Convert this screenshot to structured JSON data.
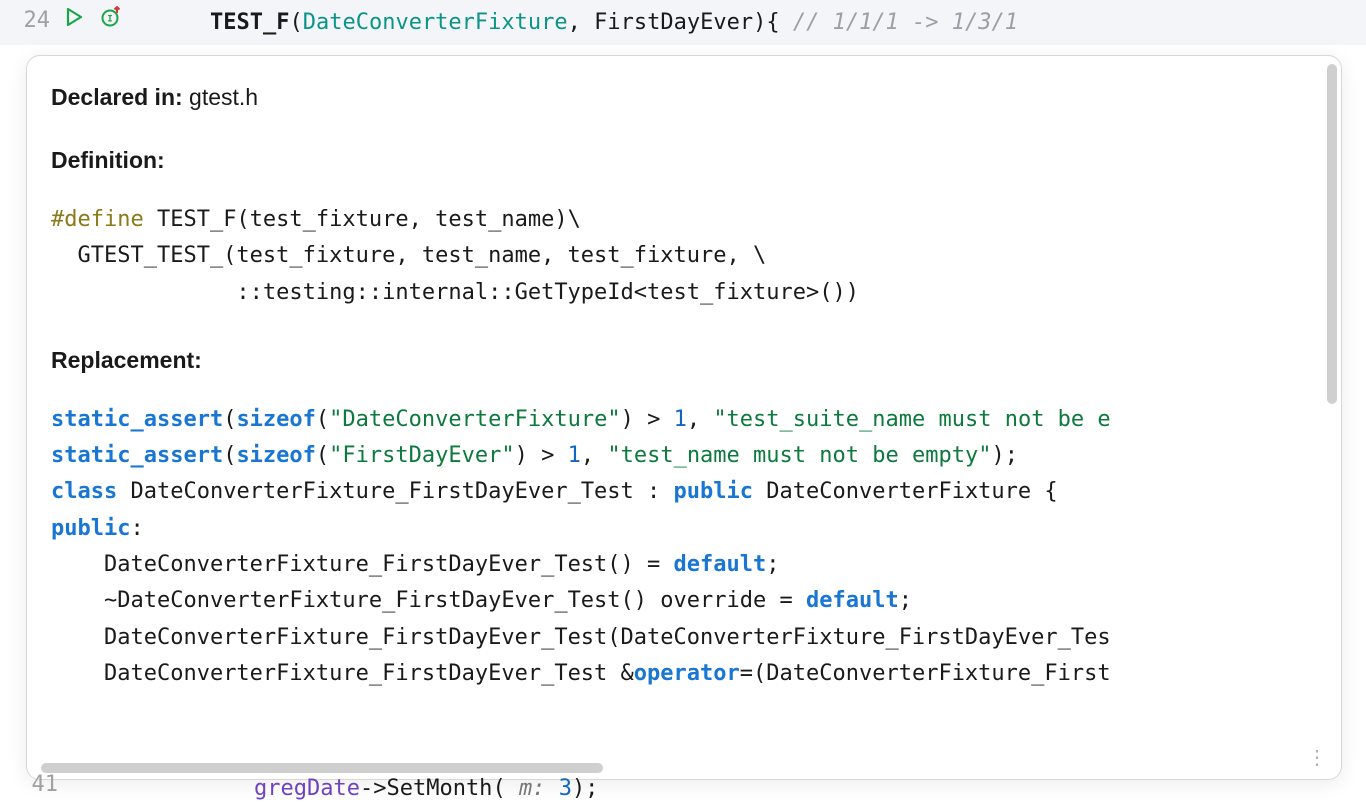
{
  "editor": {
    "line24": {
      "number": "24",
      "macro": "TEST_F",
      "arg1": "DateConverterFixture",
      "sep": ", ",
      "arg2": "FirstDayEver",
      "brace": "){ ",
      "comment": "// 1/1/1 -> 1/3/1"
    },
    "line41": {
      "number": "41",
      "indent": "        ",
      "obj": "gregDate",
      "arrow": "->",
      "method": "SetMonth",
      "open": "( ",
      "param_hint": "m: ",
      "value": "3",
      "close": ");"
    }
  },
  "tooltip": {
    "declared_in_label": "Declared in:",
    "declared_in_value": " gtest.h",
    "definition_label": "Definition:",
    "definition_code": {
      "l1_define": "#define",
      "l1_rest": " TEST_F(test_fixture, test_name)\\",
      "l2": "  GTEST_TEST_(test_fixture, test_name, test_fixture, \\",
      "l3": "              ::testing::internal::GetTypeId<test_fixture>())"
    },
    "replacement_label": "Replacement:",
    "replacement": {
      "l1": {
        "sa": "static_assert",
        "p1": "(",
        "sizeof": "sizeof",
        "p2": "(",
        "s": "\"DateConverterFixture\"",
        "p3": ") > ",
        "n": "1",
        "c": ", ",
        "s2": "\"test_suite_name must not be e"
      },
      "l2": {
        "sa": "static_assert",
        "p1": "(",
        "sizeof": "sizeof",
        "p2": "(",
        "s": "\"FirstDayEver\"",
        "p3": ") > ",
        "n": "1",
        "c": ", ",
        "s2": "\"test_name must not be empty\"",
        "end": ");"
      },
      "l3": {
        "kw1": "class",
        "name": " DateConverterFixture_FirstDayEver_Test : ",
        "kw2": "public",
        "rest": " DateConverterFixture {"
      },
      "l4": {
        "kw": "public",
        "colon": ":"
      },
      "l5": {
        "indent": "    ",
        "name": "DateConverterFixture_FirstDayEver_Test() = ",
        "kw": "default",
        "semi": ";"
      },
      "l6": {
        "indent": "    ",
        "name": "~DateConverterFixture_FirstDayEver_Test() override = ",
        "kw": "default",
        "semi": ";"
      },
      "l7": {
        "indent": "    ",
        "txt": "DateConverterFixture_FirstDayEver_Test(DateConverterFixture_FirstDayEver_Tes"
      },
      "l8": {
        "indent": "    ",
        "pre": "DateConverterFixture_FirstDayEver_Test &",
        "op": "operator",
        "post": "=(DateConverterFixture_First"
      }
    }
  },
  "icons": {
    "play": "play-icon",
    "coverage": "coverage-icon"
  }
}
